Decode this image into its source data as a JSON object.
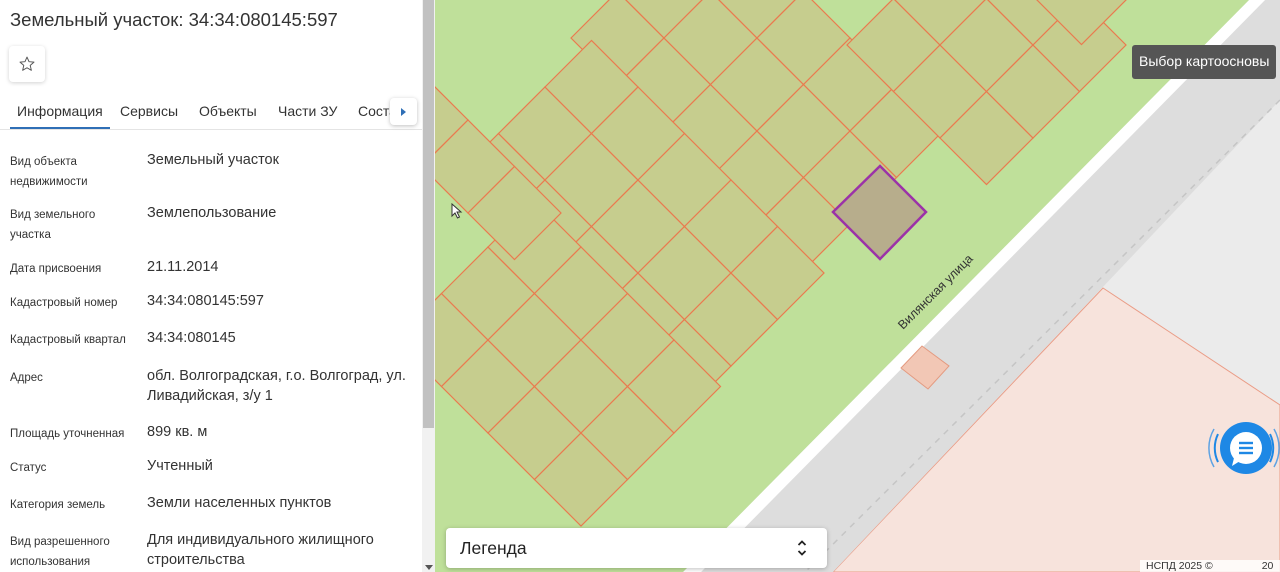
{
  "panel": {
    "title": "Земельный участок: 34:34:080145:597",
    "tabs": [
      {
        "label": "Информация",
        "active": true
      },
      {
        "label": "Сервисы"
      },
      {
        "label": "Объекты"
      },
      {
        "label": "Части ЗУ"
      },
      {
        "label": "Состав"
      }
    ],
    "fields": [
      {
        "label": "Вид объекта недвижимости",
        "value": "Земельный участок"
      },
      {
        "label": "Вид земельного участка",
        "value": "Землепользование"
      },
      {
        "label": "Дата присвоения",
        "value": "21.11.2014"
      },
      {
        "label": "Кадастровый номер",
        "value": "34:34:080145:597"
      },
      {
        "label": "Кадастровый квартал",
        "value": "34:34:080145"
      },
      {
        "label": "Адрес",
        "value": "обл. Волгоградская, г.о. Волгоград, ул. Ливадийская, з/у 1"
      },
      {
        "label": "Площадь уточненная",
        "value": "899 кв. м"
      },
      {
        "label": "Статус",
        "value": "Учтенный"
      },
      {
        "label": "Категория земель",
        "value": "Земли населенных пунктов"
      },
      {
        "label": "Вид разрешенного использования",
        "value": "Для индивидуального жилищного строительства"
      }
    ]
  },
  "map": {
    "street_label": "Вилянская улица",
    "basemap_tooltip": "Выбор картоосновы",
    "legend_label": "Легенда",
    "copyright": "НСПД 2025 ©",
    "copyright_tail": "20",
    "colors": {
      "green_zone": "#bfe09a",
      "parcel_fill": "#c6cd8e",
      "parcel_stroke": "#ea7a4f",
      "selected_stroke": "#9b32a8",
      "selected_fill": "#b7ad8c",
      "road": "#dddddd",
      "pink_zone": "#f7e3dc",
      "accent": "#1e88e5"
    }
  },
  "icons": {
    "favorite": "star-outline-icon",
    "tabs_next": "chevron-right-icon",
    "legend_toggle": "sort-arrows-icon",
    "chat": "chat-icon",
    "cursor": "mouse-pointer-icon"
  }
}
